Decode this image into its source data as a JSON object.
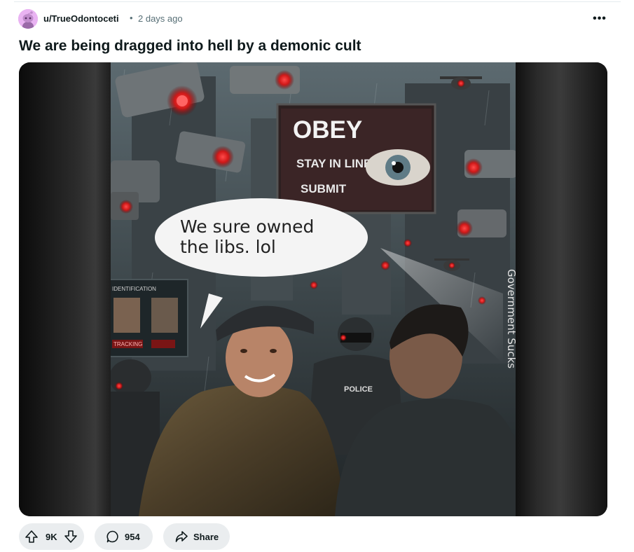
{
  "post": {
    "author": "u/TrueOdontoceti",
    "separator": "•",
    "time_ago": "2 days ago",
    "more_icon": "more-horizontal-icon",
    "title": "We are being dragged into hell by a demonic cult"
  },
  "media": {
    "speech_bubble_line1": "We sure owned",
    "speech_bubble_line2": "the libs. lol",
    "billboard_title": "OBEY",
    "billboard_line1": "STAY IN LINE",
    "billboard_line2": "SUBMIT",
    "watermark": "Government Sucks",
    "vest_label": "POLICE",
    "id_panel_title": "IDENTIFICATION",
    "id_panel_tracking": "TRACKING"
  },
  "actions": {
    "vote_count": "9K",
    "comment_count": "954",
    "share_label": "Share"
  },
  "colors": {
    "pill_bg": "#eaedef",
    "avatar_bg": "#e9b3f2",
    "meta_text": "#576f76"
  }
}
